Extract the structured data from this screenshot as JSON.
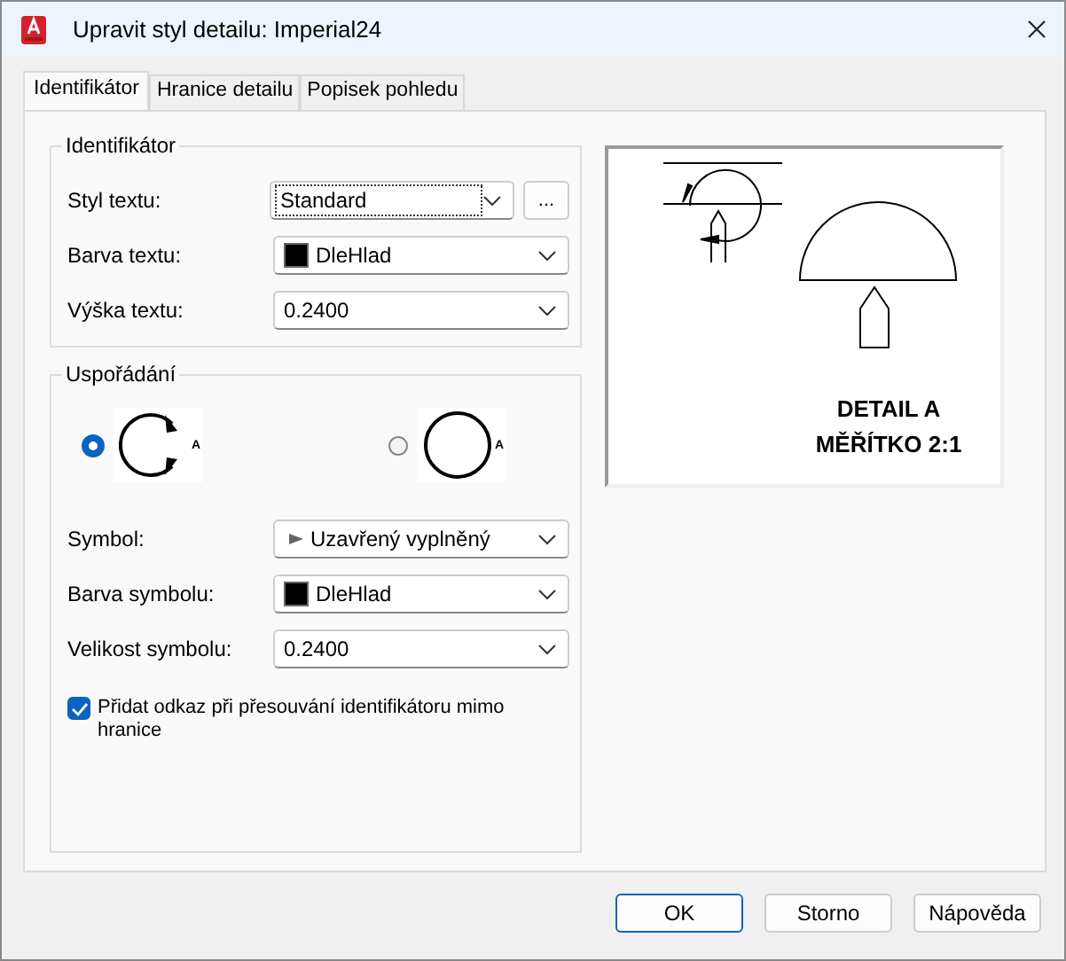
{
  "window": {
    "title": "Upravit styl detailu: Imperial24"
  },
  "tabs": [
    {
      "label": "Identifikátor",
      "selected": true
    },
    {
      "label": "Hranice detailu",
      "selected": false
    },
    {
      "label": "Popisek pohledu",
      "selected": false
    }
  ],
  "identifier_group": {
    "title": "Identifikátor",
    "fields": [
      {
        "label": "Styl textu:",
        "value": "Standard",
        "kind": "plain",
        "focused": true,
        "browse_button": "..."
      },
      {
        "label": "Barva textu:",
        "value": "DleHlad",
        "kind": "color",
        "focused": false
      },
      {
        "label": "Výška textu:",
        "value": "0.2400",
        "kind": "plain",
        "focused": false
      }
    ]
  },
  "arrangement_group": {
    "title": "Uspořádání",
    "options": [
      {
        "kind": "arrows",
        "label": "A",
        "selected": true
      },
      {
        "kind": "plain",
        "label": "A",
        "selected": false
      }
    ],
    "fields": [
      {
        "label": "Symbol:",
        "value": "Uzavřený vyplněný",
        "kind": "arrow",
        "focused": false
      },
      {
        "label": "Barva symbolu:",
        "value": "DleHlad",
        "kind": "color",
        "focused": false
      },
      {
        "label": "Velikost symbolu:",
        "value": "0.2400",
        "kind": "plain",
        "focused": false
      }
    ],
    "checkbox": {
      "label": "Přidat odkaz při přesouvání identifikátoru mimo hranice",
      "checked": true
    }
  },
  "preview": {
    "lines": [
      "DETAIL A",
      "MĚŘÍTKO 2:1"
    ]
  },
  "buttons": [
    {
      "label": "OK",
      "default": true
    },
    {
      "label": "Storno",
      "default": false
    },
    {
      "label": "Nápověda",
      "default": false
    }
  ]
}
